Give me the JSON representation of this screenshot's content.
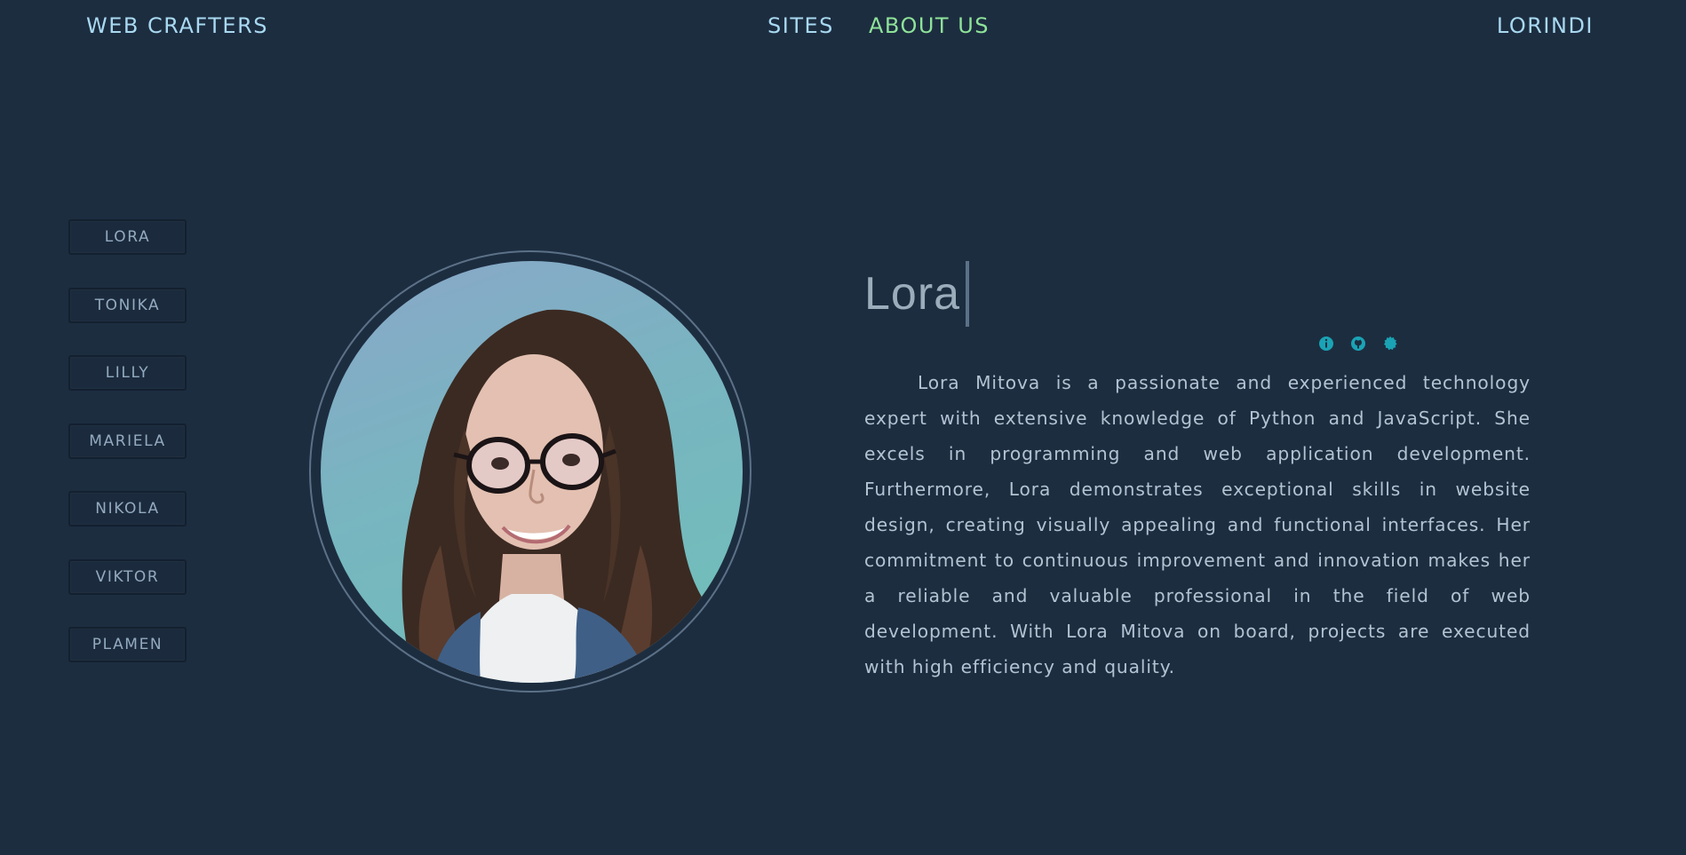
{
  "nav": {
    "brand": "WEB CRAFTERS",
    "links": [
      {
        "label": "SITES",
        "active": false
      },
      {
        "label": "ABOUT US",
        "active": true
      }
    ],
    "user": "LORINDI"
  },
  "team": [
    "LORA",
    "TONIKA",
    "LILLY",
    "MARIELA",
    "NIKOLA",
    "VIKTOR",
    "PLAMEN"
  ],
  "profile": {
    "name": "Lora",
    "bio": "Lora Mitova is a passionate and experienced technology expert with extensive knowledge of Python and JavaScript. She excels in programming and web application development. Furthermore, Lora demonstrates exceptional skills in website design, creating visually appealing and functional interfaces. Her commitment to continuous improvement and innovation makes her a reliable and valuable professional in the field of web development. With Lora Mitova on board, projects are executed with high efficiency and quality.",
    "socials": [
      "info-icon",
      "github-icon",
      "badge-icon"
    ]
  },
  "colors": {
    "background": "#1d2d40",
    "nav_text": "#a8d9f1",
    "nav_active": "#8ee399",
    "social_accent": "#1aa3b4"
  }
}
